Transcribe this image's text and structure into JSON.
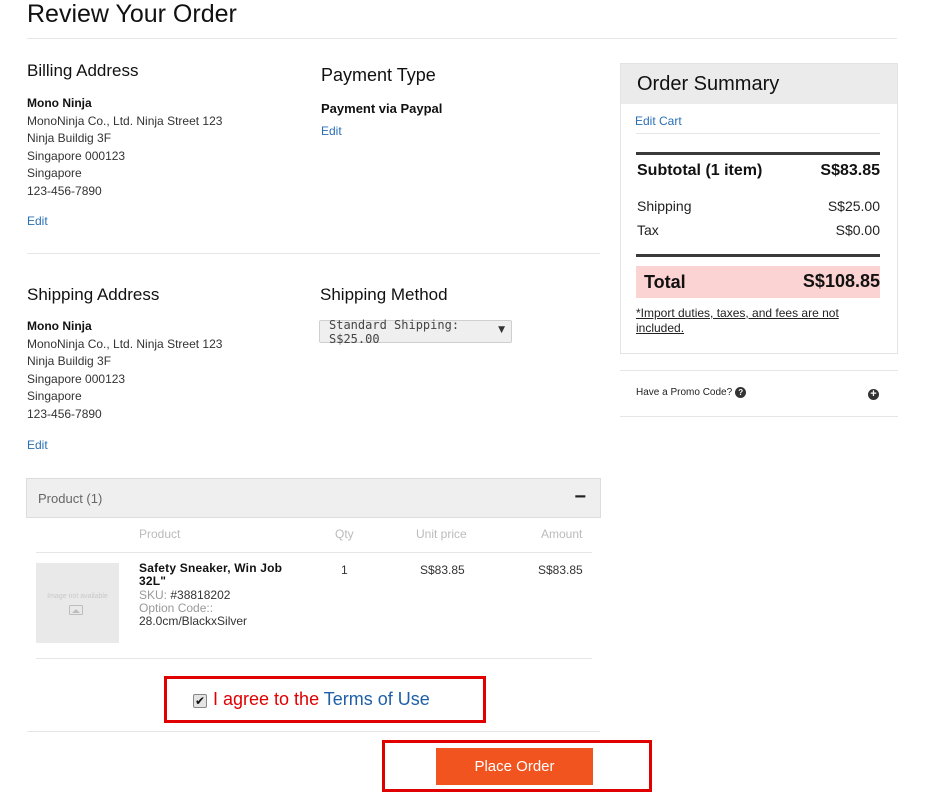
{
  "page": {
    "title": "Review Your Order"
  },
  "billing": {
    "heading": "Billing Address",
    "name": "Mono Ninja",
    "lines": [
      "MonoNinja Co., Ltd. Ninja Street 123",
      "Ninja Buildig 3F",
      "Singapore 000123",
      "Singapore",
      "123-456-7890"
    ],
    "edit_label": "Edit"
  },
  "payment": {
    "heading": "Payment Type",
    "method": "Payment via Paypal",
    "edit_label": "Edit"
  },
  "shipping_address": {
    "heading": "Shipping Address",
    "name": "Mono Ninja",
    "lines": [
      "MonoNinja Co., Ltd. Ninja Street 123",
      "Ninja Buildig 3F",
      "Singapore 000123",
      "Singapore",
      "123-456-7890"
    ],
    "edit_label": "Edit"
  },
  "shipping_method": {
    "heading": "Shipping Method",
    "selected": "Standard Shipping: S$25.00",
    "caret": "▼"
  },
  "products": {
    "header_label": "Product (1)",
    "collapse_symbol": "−",
    "columns": {
      "product": "Product",
      "qty": "Qty",
      "unit_price": "Unit price",
      "amount": "Amount"
    },
    "items": [
      {
        "image_placeholder": "Image not available",
        "name": "Safety Sneaker, Win Job 32L\"",
        "sku_label": "SKU:",
        "sku": "#38818202",
        "option_label": "Option Code::",
        "option_value": "28.0cm/BlackxSilver",
        "qty": "1",
        "unit_price": "S$83.85",
        "amount": "S$83.85"
      }
    ]
  },
  "terms": {
    "checked": true,
    "prefix": "I agree to the ",
    "link": "Terms of Use",
    "accent_color": "#e00000"
  },
  "place_order": {
    "label": "Place Order",
    "color": "#f1541f"
  },
  "summary": {
    "heading": "Order Summary",
    "edit_cart": "Edit Cart",
    "subtotal_label": "Subtotal (1 item)",
    "subtotal_value": "S$83.85",
    "shipping_label": "Shipping",
    "shipping_value": "S$25.00",
    "tax_label": "Tax",
    "tax_value": "S$0.00",
    "total_label": "Total",
    "total_value": "S$108.85",
    "total_bg": "#fcd3d3",
    "duties_note": "*Import duties, taxes, and fees are not included."
  },
  "promo": {
    "label": "Have a Promo Code?",
    "help_icon": "?",
    "expand_icon": "+"
  },
  "icons": {
    "checkbox": "checkmark-icon",
    "help": "question-icon",
    "expand": "plus-circle-icon",
    "image": "image-placeholder-icon"
  }
}
